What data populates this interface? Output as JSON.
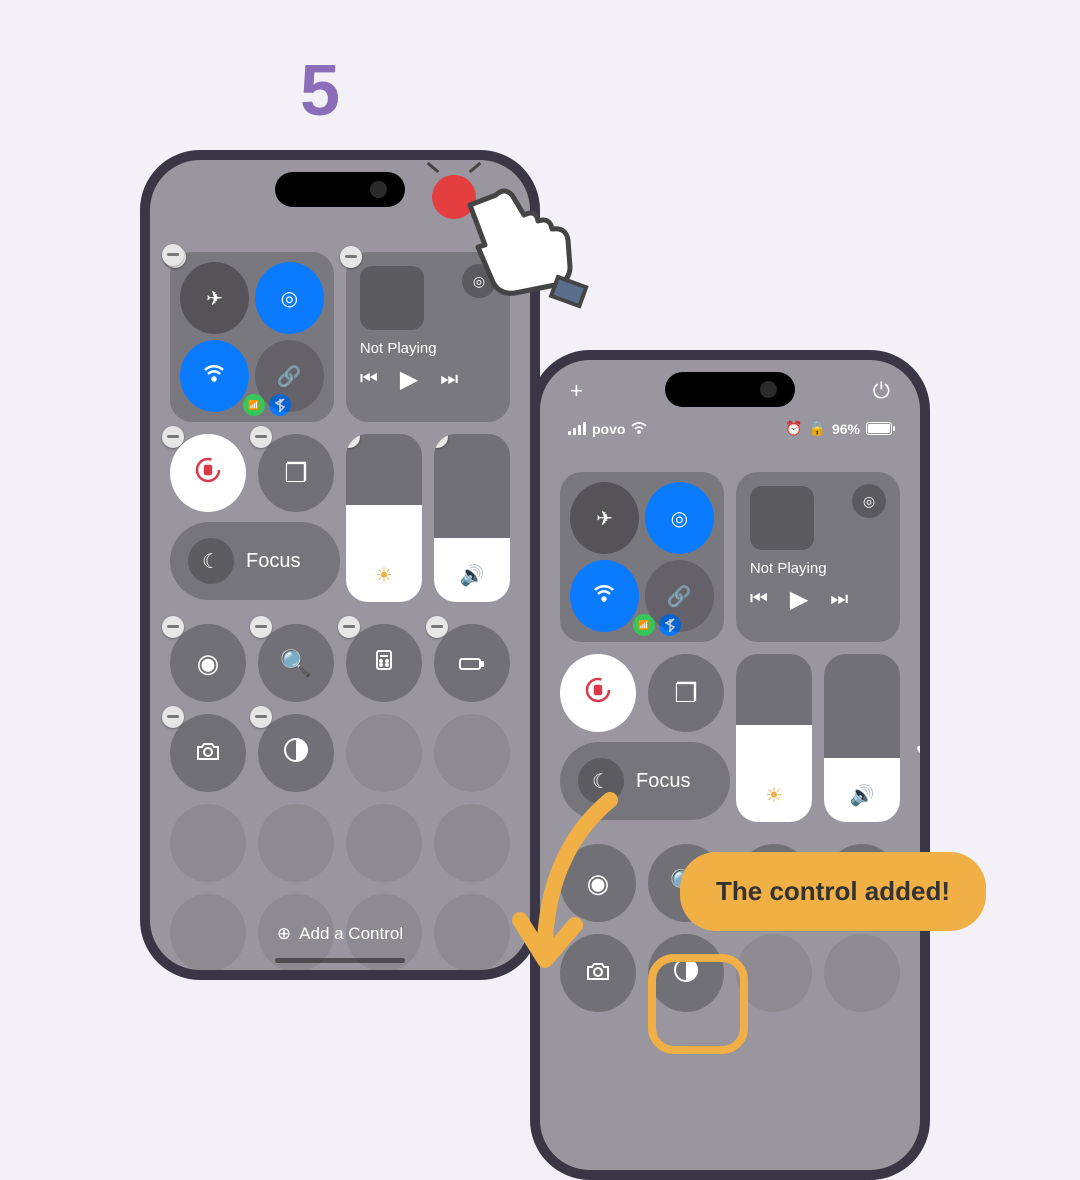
{
  "step_number": "5",
  "phone1": {
    "connectivity": {
      "airplane_active": false,
      "airdrop_active": true,
      "wifi_active": true,
      "cellular_group": true
    },
    "music": {
      "status": "Not Playing"
    },
    "focus": {
      "label": "Focus"
    },
    "brightness_level": 60,
    "volume_level": 40,
    "add_control_label": "Add a Control"
  },
  "phone2": {
    "status": {
      "carrier": "povo",
      "battery_percent": "96%"
    },
    "music": {
      "status": "Not Playing"
    },
    "focus": {
      "label": "Focus"
    },
    "brightness_level": 60,
    "volume_level": 40
  },
  "callout_text": "The control added!"
}
